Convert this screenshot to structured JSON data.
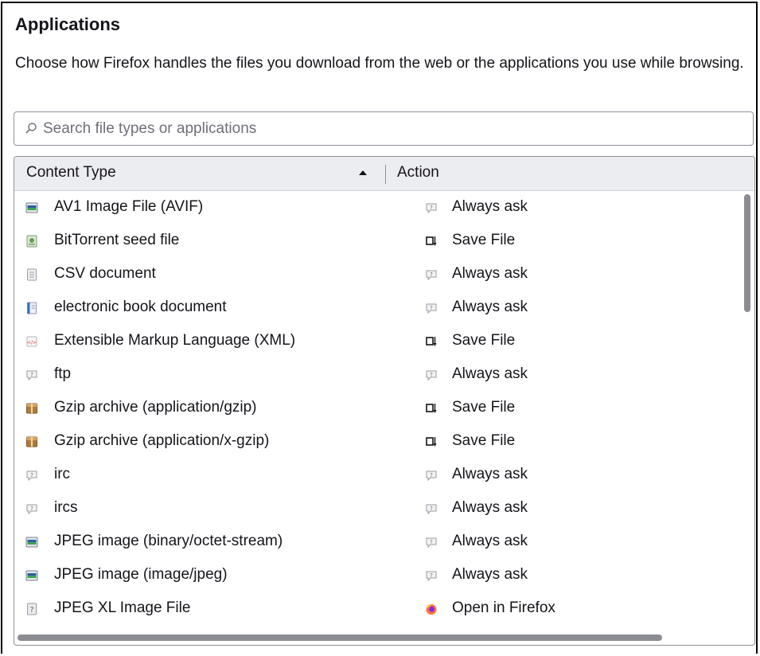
{
  "section": {
    "title": "Applications",
    "description": "Choose how Firefox handles the files you download from the web or the applications you use while browsing."
  },
  "search": {
    "placeholder": "Search file types or applications",
    "value": ""
  },
  "table": {
    "columns": {
      "content_type": "Content Type",
      "action": "Action"
    },
    "sort": "ascending",
    "rows": [
      {
        "type": "AV1 Image File (AVIF)",
        "type_icon": "image-file-icon",
        "action": "Always ask",
        "action_icon": "always-ask-icon"
      },
      {
        "type": "BitTorrent seed file",
        "type_icon": "torrent-file-icon",
        "action": "Save File",
        "action_icon": "save-file-icon"
      },
      {
        "type": "CSV document",
        "type_icon": "text-document-icon",
        "action": "Always ask",
        "action_icon": "always-ask-icon"
      },
      {
        "type": "electronic book document",
        "type_icon": "ebook-icon",
        "action": "Always ask",
        "action_icon": "always-ask-icon"
      },
      {
        "type": "Extensible Markup Language (XML)",
        "type_icon": "xml-file-icon",
        "action": "Save File",
        "action_icon": "save-file-icon"
      },
      {
        "type": "ftp",
        "type_icon": "protocol-icon",
        "action": "Always ask",
        "action_icon": "always-ask-icon"
      },
      {
        "type": "Gzip archive (application/gzip)",
        "type_icon": "archive-icon",
        "action": "Save File",
        "action_icon": "save-file-icon"
      },
      {
        "type": "Gzip archive (application/x-gzip)",
        "type_icon": "archive-icon",
        "action": "Save File",
        "action_icon": "save-file-icon"
      },
      {
        "type": "irc",
        "type_icon": "protocol-icon",
        "action": "Always ask",
        "action_icon": "always-ask-icon"
      },
      {
        "type": "ircs",
        "type_icon": "protocol-icon",
        "action": "Always ask",
        "action_icon": "always-ask-icon"
      },
      {
        "type": "JPEG image (binary/octet-stream)",
        "type_icon": "image-file-icon",
        "action": "Always ask",
        "action_icon": "always-ask-icon"
      },
      {
        "type": "JPEG image (image/jpeg)",
        "type_icon": "image-file-icon",
        "action": "Always ask",
        "action_icon": "always-ask-icon"
      },
      {
        "type": "JPEG XL Image File",
        "type_icon": "unknown-file-icon",
        "action": "Open in Firefox",
        "action_icon": "firefox-icon"
      }
    ]
  }
}
